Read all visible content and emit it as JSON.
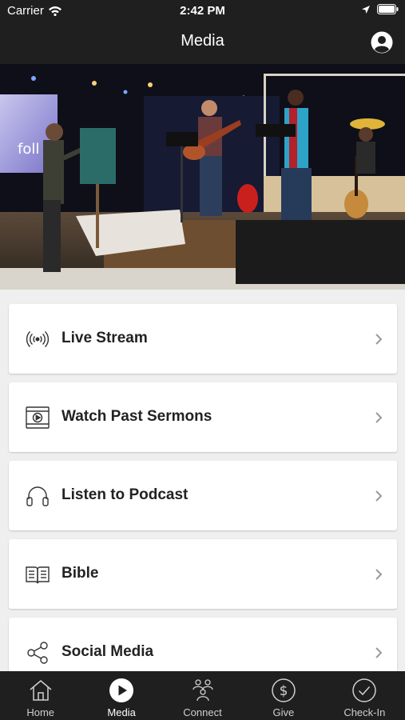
{
  "status_bar": {
    "carrier": "Carrier",
    "time": "2:42 PM"
  },
  "header": {
    "title": "Media"
  },
  "hero": {
    "description_icon": "worship-band-photo"
  },
  "menu": [
    {
      "label": "Live Stream",
      "icon": "broadcast-icon"
    },
    {
      "label": "Watch Past Sermons",
      "icon": "video-play-icon"
    },
    {
      "label": "Listen to Podcast",
      "icon": "headphones-icon"
    },
    {
      "label": "Bible",
      "icon": "open-book-icon"
    },
    {
      "label": "Social Media",
      "icon": "share-icon"
    }
  ],
  "tabs": [
    {
      "label": "Home",
      "icon": "home-icon",
      "active": false
    },
    {
      "label": "Media",
      "icon": "play-icon",
      "active": true
    },
    {
      "label": "Connect",
      "icon": "people-icon",
      "active": false
    },
    {
      "label": "Give",
      "icon": "dollar-icon",
      "active": false
    },
    {
      "label": "Check-In",
      "icon": "check-icon",
      "active": false
    }
  ],
  "colors": {
    "bar_background": "#1f1f1f",
    "page_background": "#efefef",
    "card_background": "#ffffff",
    "chevron": "#9a9a9a"
  }
}
